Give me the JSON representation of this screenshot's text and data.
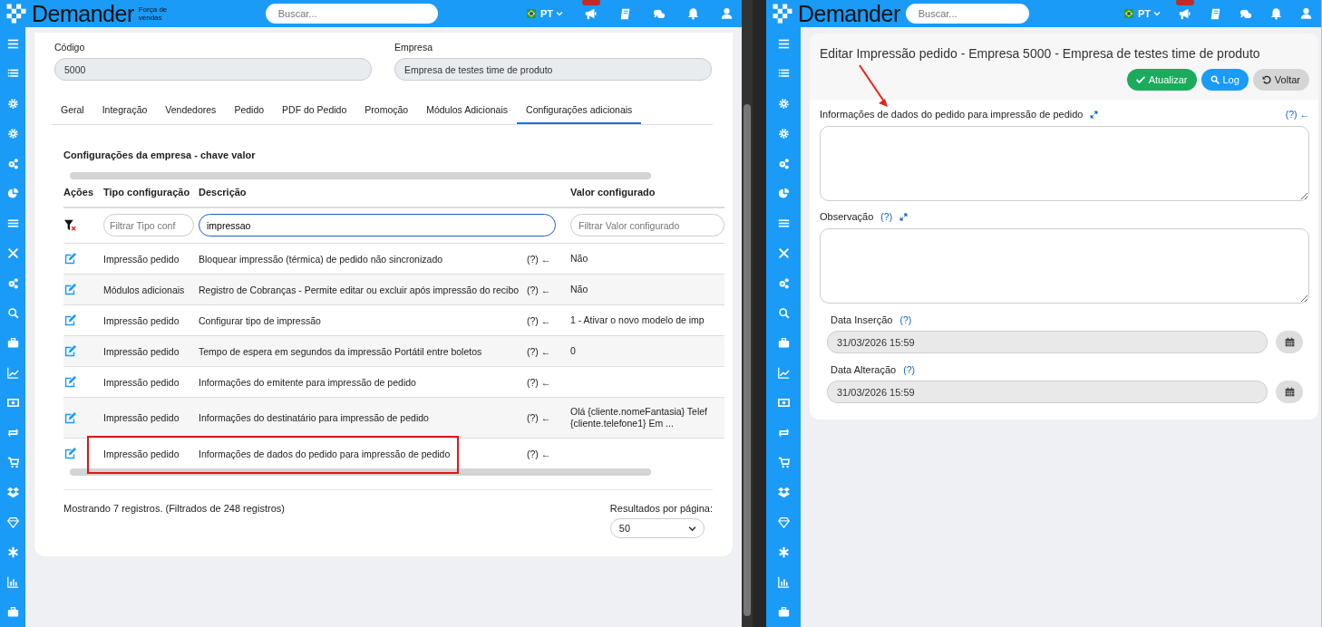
{
  "left_window": {
    "header": {
      "logo": "Demander",
      "tagline": "Força de vendas",
      "search": {
        "placeholder": "Buscar..."
      },
      "language": "PT"
    },
    "fields": [
      {
        "label": "Código",
        "value": "5000"
      },
      {
        "label": "Empresa",
        "value": "Empresa de testes time de produto"
      }
    ],
    "tabs": [
      {
        "label": "Geral",
        "selected": false
      },
      {
        "label": "Integração",
        "selected": false
      },
      {
        "label": "Vendedores",
        "selected": false
      },
      {
        "label": "Pedido",
        "selected": false
      },
      {
        "label": "PDF do Pedido",
        "selected": false
      },
      {
        "label": "Promoção",
        "selected": false
      },
      {
        "label": "Módulos Adicionais",
        "selected": false
      },
      {
        "label": "Configurações adicionais",
        "selected": true
      }
    ],
    "section_title": "Configurações da empresa - chave valor",
    "table": {
      "columns": [
        "Ações",
        "Tipo configuração",
        "Descrição",
        "Valor configurado"
      ],
      "filters": [
        {
          "placeholder": "Filtrar Tipo conf",
          "focused": false
        },
        {
          "value": "impressao",
          "focused": true
        },
        {
          "placeholder": "Filtrar Valor configurado",
          "focused": false
        }
      ],
      "rows": [
        {
          "type": "Impressão pedido",
          "description": "Bloquear impressão (térmica) de pedido não sincronizado",
          "help": "(?) ←",
          "value": "Não",
          "highlighted": false
        },
        {
          "type": "Módulos adicionais",
          "description": "Registro de Cobranças - Permite editar ou excluir após impressão do recibo",
          "help": "(?) ←",
          "value": "Não",
          "highlighted": false
        },
        {
          "type": "Impressão pedido",
          "description": "Configurar tipo de impressão",
          "help": "(?) ←",
          "value": "1 - Ativar o novo modelo de imp",
          "highlighted": false
        },
        {
          "type": "Impressão pedido",
          "description": "Tempo de espera em segundos da impressão Portátil entre boletos",
          "help": "(?) ←",
          "value": "0",
          "highlighted": false
        },
        {
          "type": "Impressão pedido",
          "description": "Informações do emitente para impressão de pedido",
          "help": "(?) ←",
          "highlighted": false
        },
        {
          "type": "Impressão pedido",
          "description": "Informações do destinatário para impressão de pedido",
          "help": "(?) ←",
          "value": "Olá {cliente.nomeFantasia} Telef\n{cliente.telefone1} Em ...",
          "highlighted": false
        },
        {
          "type": "Impressão pedido",
          "description": "Informações de dados do pedido para impressão de pedido",
          "help": "(?) ←",
          "highlighted": true
        }
      ]
    },
    "footer": {
      "summary": "Mostrando 7 registros. (Filtrados de 248 registros)",
      "page_size_label": "Resultados por página:",
      "page_size": "50"
    }
  },
  "right_window": {
    "header": {
      "logo": "Demander",
      "search": {
        "placeholder": "Buscar..."
      },
      "language": "PT"
    },
    "edit_panel": {
      "title": "Editar Impressão pedido - Empresa 5000 - Empresa de testes time de produto",
      "buttons": [
        {
          "label": "Atualizar",
          "kind": "success"
        },
        {
          "label": "Log",
          "kind": "primary"
        },
        {
          "label": "Voltar",
          "kind": "secondary"
        }
      ],
      "annotation_arrow": true,
      "text_fields": [
        {
          "label": "Informações de dados do pedido para impressão de pedido",
          "help": "(?) ←",
          "kind": "trailing"
        },
        {
          "label": "Observação",
          "help": "(?)",
          "kind": "inline"
        }
      ],
      "date_fields": [
        {
          "label": "Data Inserção",
          "help": "(?)",
          "value": "31/03/2026 15:59"
        },
        {
          "label": "Data Alteração",
          "help": "(?)",
          "value": "31/03/2026 15:59"
        }
      ]
    }
  }
}
